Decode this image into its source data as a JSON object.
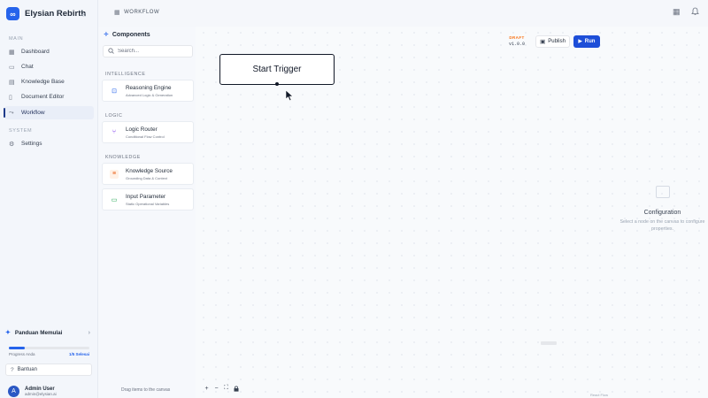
{
  "app": {
    "name": "Elysian Rebirth",
    "logo_glyph": "∞",
    "accent": "#2563eb"
  },
  "sidebar": {
    "collapse_icon": "chevrons-left-icon",
    "main_label": "MAIN",
    "items": [
      {
        "label": "Dashboard",
        "icon": "dashboard-icon"
      },
      {
        "label": "Chat",
        "icon": "chat-icon"
      },
      {
        "label": "Knowledge Base",
        "icon": "book-icon"
      },
      {
        "label": "Document Editor",
        "icon": "document-icon"
      },
      {
        "label": "Workflow",
        "icon": "workflow-icon",
        "active": true
      }
    ],
    "system_label": "SYSTEM",
    "system_items": [
      {
        "label": "Settings",
        "icon": "gear-icon"
      }
    ],
    "guide": {
      "title": "Panduan Memulai",
      "progress_label": "Progress Anda",
      "progress_value": "1/5 Selesai",
      "progress_fraction": 0.2
    },
    "help_label": "Bantuan",
    "user": {
      "name": "Admin User",
      "email": "admin@elysian.ai",
      "initial": "A"
    }
  },
  "topbar": {
    "breadcrumb": "WORKFLOW"
  },
  "components": {
    "title": "Components",
    "search_placeholder": "Search...",
    "categories": [
      {
        "label": "INTELLIGENCE",
        "items": [
          {
            "title": "Reasoning Engine",
            "subtitle": "Advanced Logic & Generation",
            "color": "#2563eb"
          }
        ]
      },
      {
        "label": "LOGIC",
        "items": [
          {
            "title": "Logic Router",
            "subtitle": "Conditional Flow Control",
            "color": "#7c3aed"
          }
        ]
      },
      {
        "label": "KNOWLEDGE",
        "items": [
          {
            "title": "Knowledge Source",
            "subtitle": "Grounding Data & Context",
            "color": "#ea580c"
          },
          {
            "title": "Input Parameter",
            "subtitle": "Static Operational Variables",
            "color": "#16a34a"
          }
        ]
      }
    ]
  },
  "canvas": {
    "node_label": "Start Trigger",
    "hint": "Drag items to the canvas",
    "attribution": "React Flow"
  },
  "toolbar": {
    "status": "DRAFT",
    "version": "v1.0.0",
    "publish_label": "Publish",
    "run_label": "Run"
  },
  "config": {
    "title": "Configuration",
    "description_line1": "Select a node on the canvas to configure",
    "description_line2": "properties."
  }
}
